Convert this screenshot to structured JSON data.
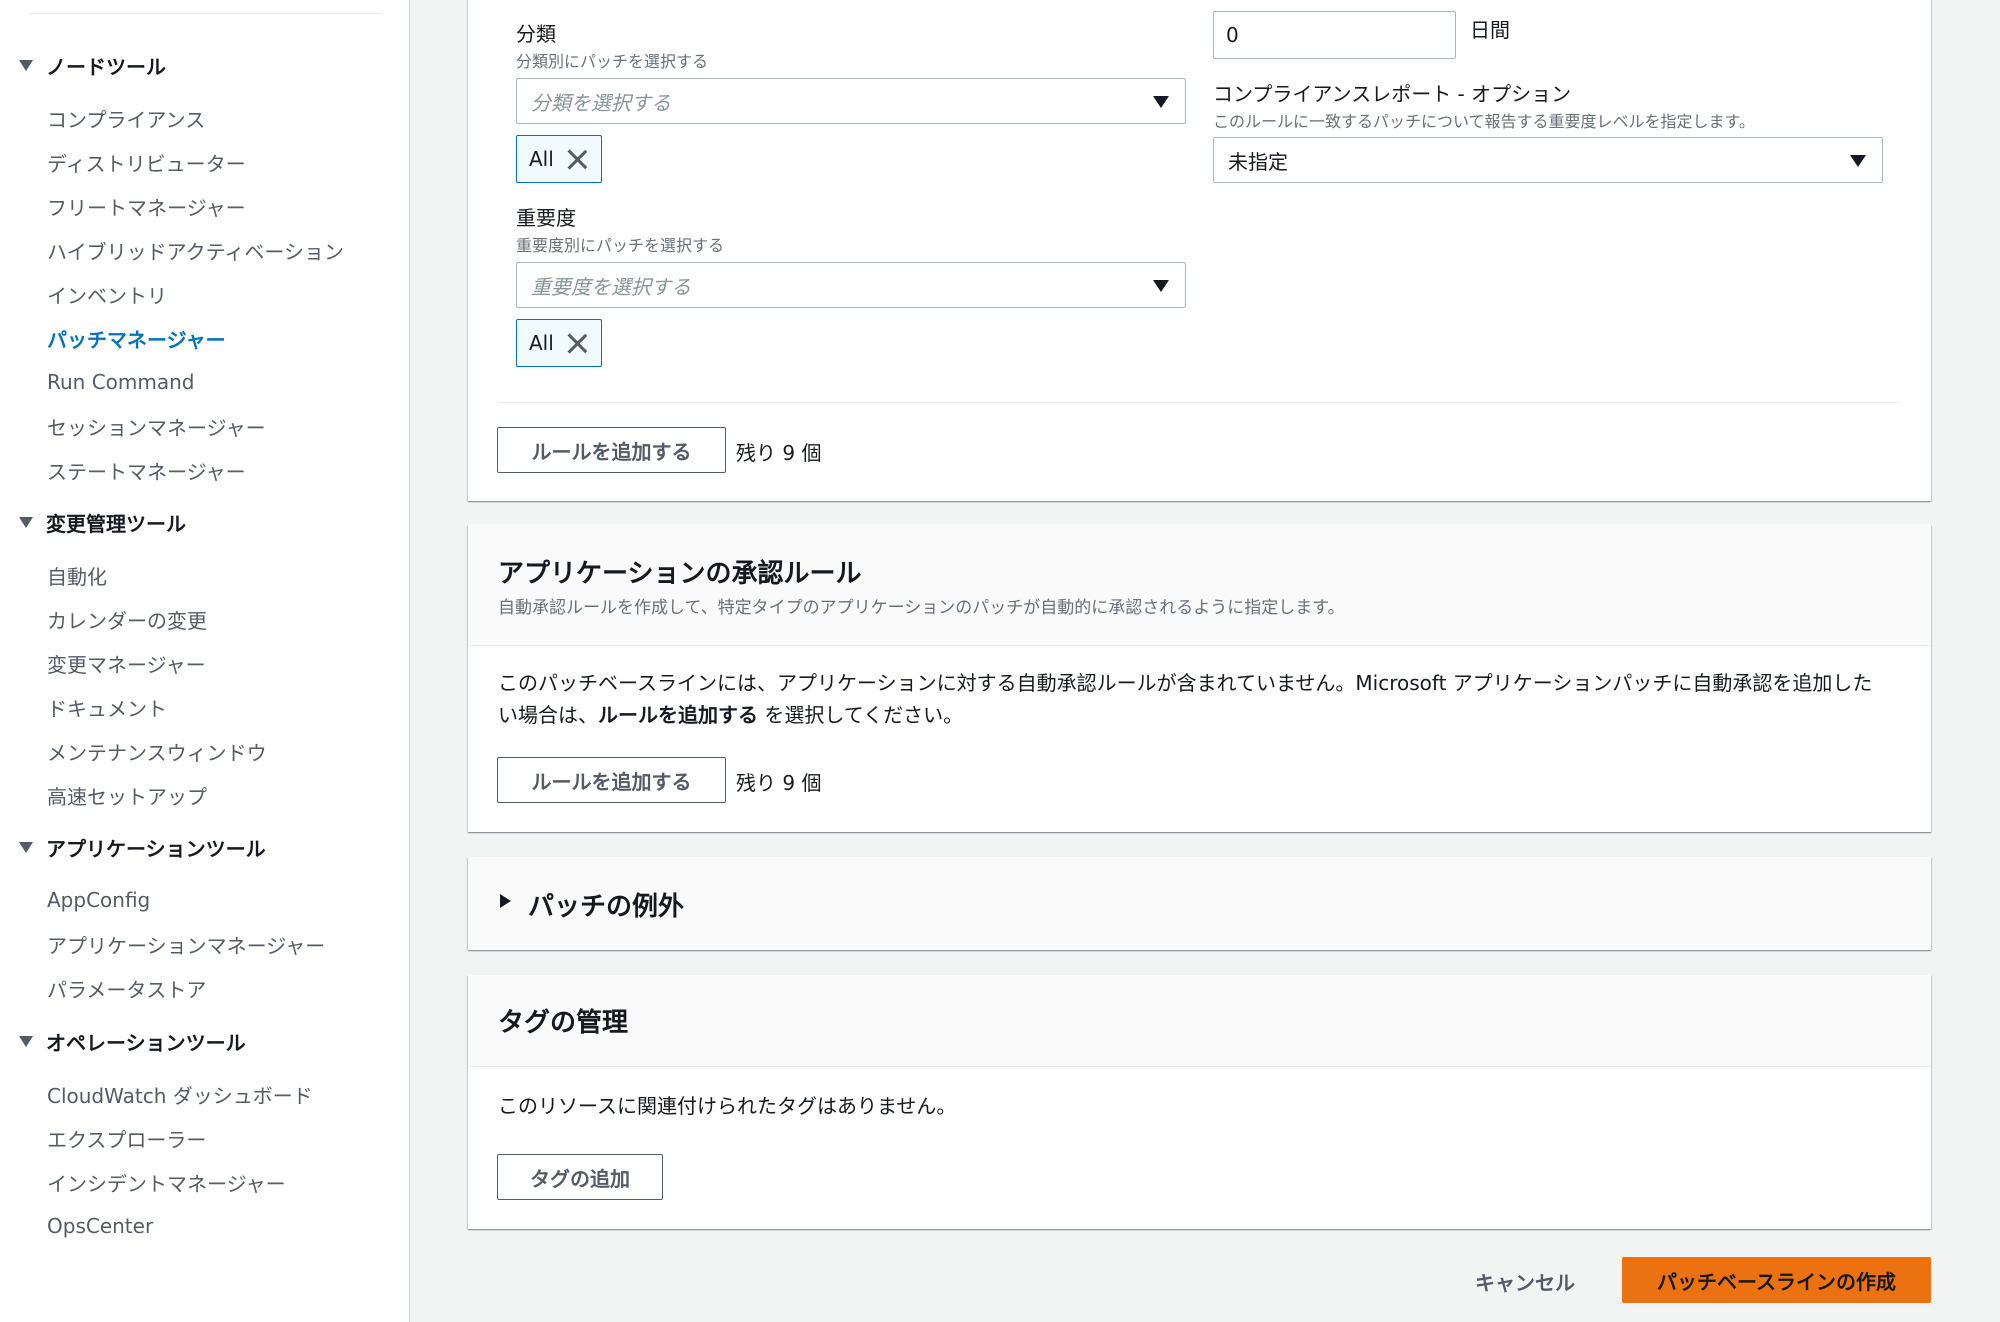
{
  "sidebar": {
    "sections": [
      {
        "title": "ノードツール",
        "items": [
          "コンプライアンス",
          "ディストリビューター",
          "フリートマネージャー",
          "ハイブリッドアクティベーション",
          "インベントリ",
          "パッチマネージャー",
          "Run Command",
          "セッションマネージャー",
          "ステートマネージャー"
        ]
      },
      {
        "title": "変更管理ツール",
        "items": [
          "自動化",
          "カレンダーの変更",
          "変更マネージャー",
          "ドキュメント",
          "メンテナンスウィンドウ",
          "高速セットアップ"
        ]
      },
      {
        "title": "アプリケーションツール",
        "items": [
          "AppConfig",
          "アプリケーションマネージャー",
          "パラメータストア"
        ]
      },
      {
        "title": "オペレーションツール",
        "items": [
          "CloudWatch ダッシュボード",
          "エクスプローラー",
          "インシデントマネージャー",
          "OpsCenter"
        ]
      }
    ],
    "active_item": "パッチマネージャー"
  },
  "os_rule": {
    "classification": {
      "label": "分類",
      "description": "分類別にパッチを選択する",
      "placeholder": "分類を選択する",
      "token": "All"
    },
    "severity": {
      "label": "重要度",
      "description": "重要度別にパッチを選択する",
      "placeholder": "重要度を選択する",
      "token": "All"
    },
    "approval_days": {
      "value": "0",
      "unit": "日間"
    },
    "compliance_report": {
      "label": "コンプライアンスレポート - オプション",
      "description": "このルールに一致するパッチについて報告する重要度レベルを指定します。",
      "value": "未指定"
    },
    "add_rule_button": "ルールを追加する",
    "remaining": "残り 9 個"
  },
  "app_rules": {
    "title": "アプリケーションの承認ルール",
    "description": "自動承認ルールを作成して、特定タイプのアプリケーションのパッチが自動的に承認されるように指定します。",
    "body_line1": "このパッチベースラインには、アプリケーションに対する自動承認ルールが含まれていません。Microsoft アプリケーションパッチに自動承認を追加した",
    "body_line2_prefix": "い場合は、",
    "body_line2_bold": "ルールを追加する",
    "body_line2_suffix": " を選択してください。",
    "add_rule_button": "ルールを追加する",
    "remaining": "残り 9 個"
  },
  "patch_exceptions": {
    "title": "パッチの例外"
  },
  "tags": {
    "title": "タグの管理",
    "empty_text": "このリソースに関連付けられたタグはありません。",
    "add_button": "タグの追加"
  },
  "footer": {
    "cancel": "キャンセル",
    "create": "パッチベースラインの作成"
  },
  "colors": {
    "primary_button": "#ec7211",
    "active_link": "#0073bb",
    "token_border": "#0073bb"
  }
}
